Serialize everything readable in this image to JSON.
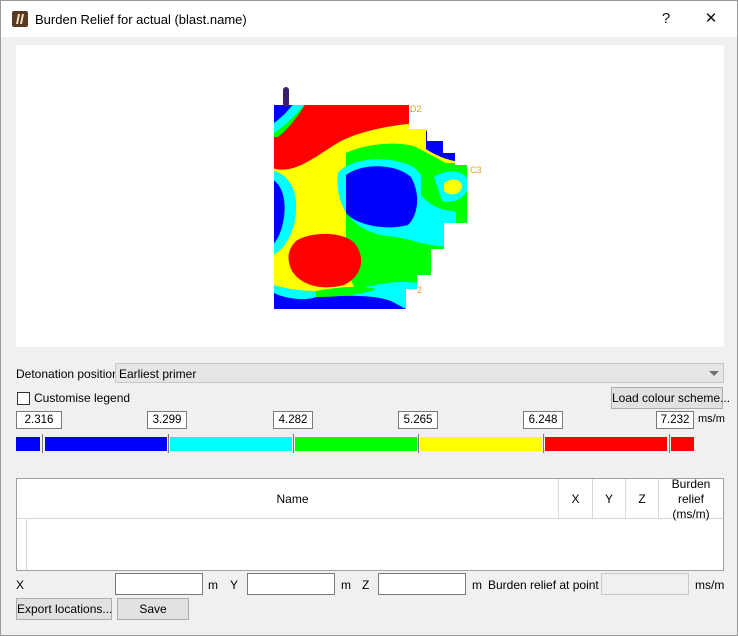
{
  "window": {
    "title": "Burden Relief for actual (blast.name)",
    "help_label": "?",
    "close_label": "✕"
  },
  "preview": {
    "labels": [
      "D2",
      "C3",
      "2"
    ]
  },
  "detonation": {
    "label": "Detonation position",
    "selected": "Earliest primer"
  },
  "legend": {
    "customise_label": "Customise legend",
    "customise_checked": false,
    "load_button": "Load colour scheme...",
    "ticks": [
      "2.316",
      "3.299",
      "4.282",
      "5.265",
      "6.248",
      "7.232"
    ],
    "unit": "ms/m",
    "colors": [
      "#0000ff",
      "#00ffff",
      "#00ff00",
      "#ffff00",
      "#ff0000"
    ]
  },
  "table": {
    "columns": [
      "Name",
      "X",
      "Y",
      "Z",
      "Burden relief\n(ms/m)"
    ],
    "rows": []
  },
  "point": {
    "x_label": "X",
    "x_unit": "m",
    "y_label": "Y",
    "y_unit": "m",
    "z_label": "Z",
    "z_unit": "m",
    "relief_label": "Burden relief at point",
    "relief_unit": "ms/m",
    "x_value": "",
    "y_value": "",
    "z_value": "",
    "relief_value": ""
  },
  "actions": {
    "export_label": "Export locations...",
    "save_label": "Save"
  }
}
